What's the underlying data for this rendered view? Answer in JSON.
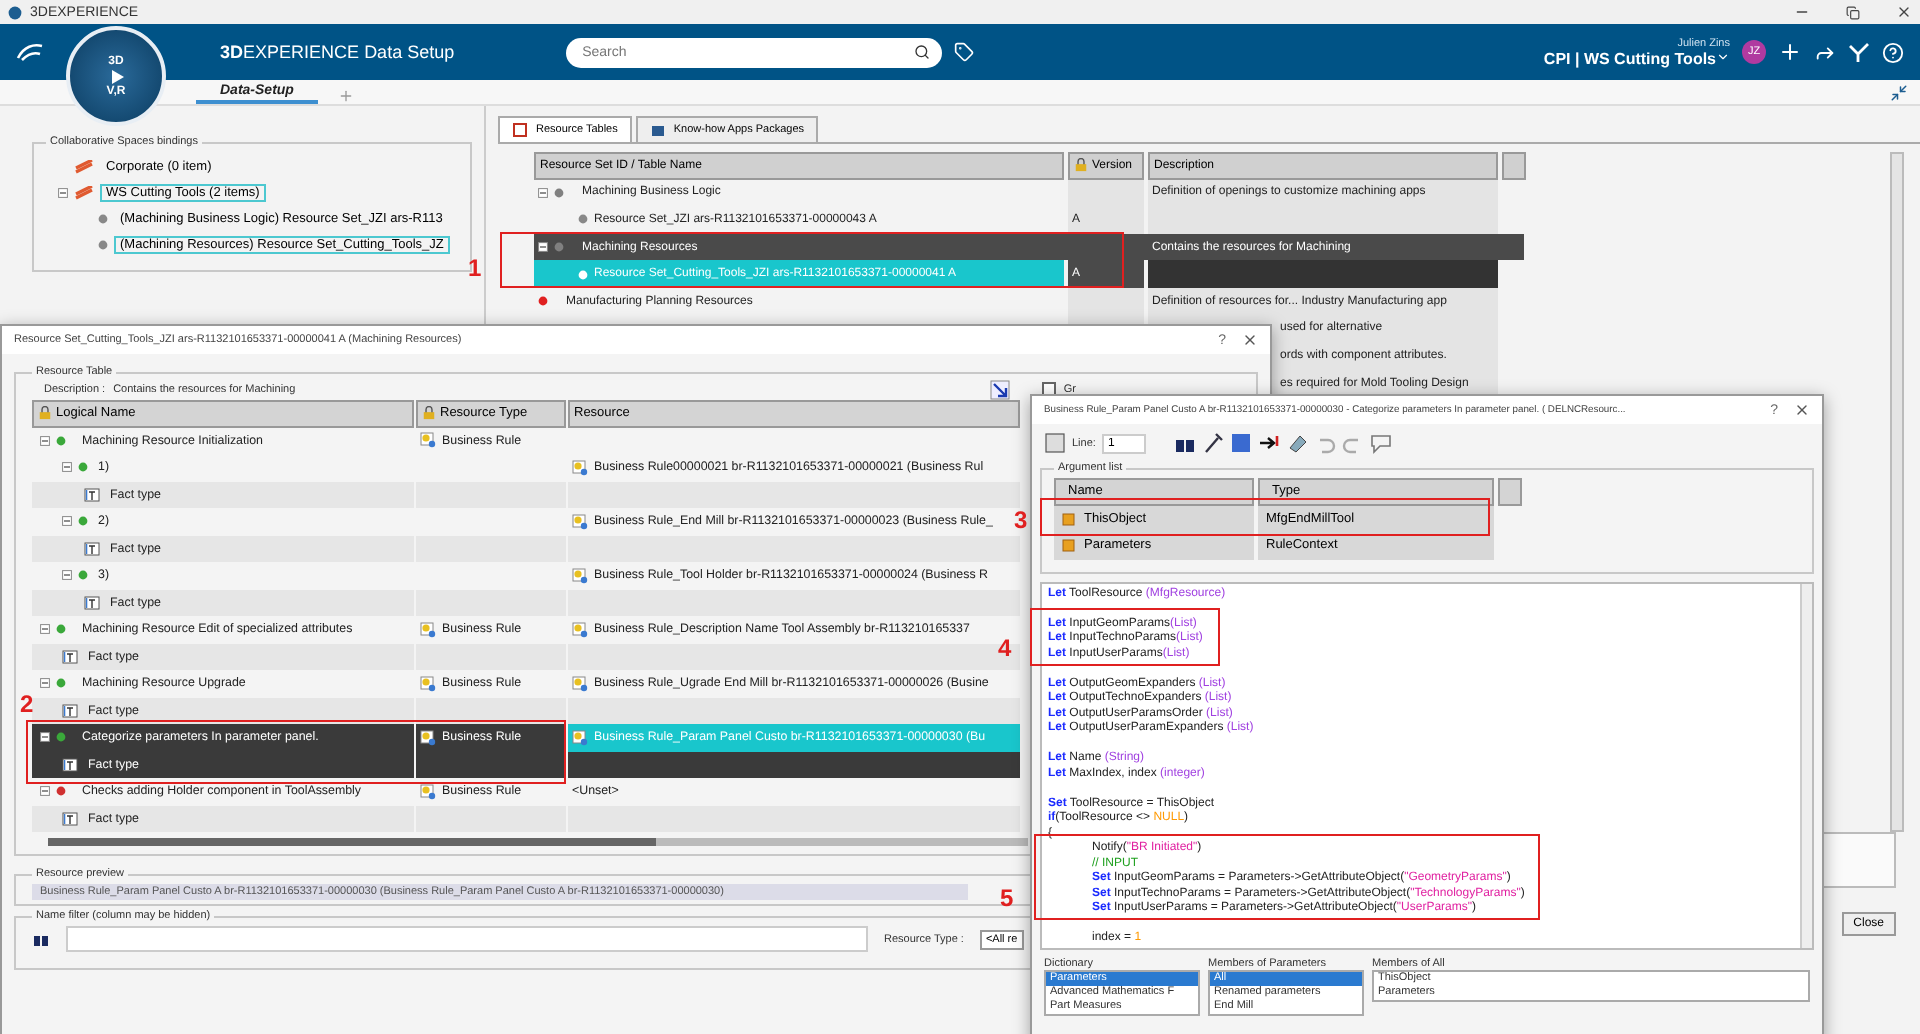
{
  "app_title": "3DEXPERIENCE",
  "header": {
    "brand_bold": "3D",
    "brand_rest": "EXPERIENCE",
    "app_name": "Data Setup",
    "compass_left": "3D",
    "compass_bottom": "V,R",
    "search": {
      "placeholder": "Search"
    },
    "user_name": "Julien Zins",
    "context": "CPI | WS Cutting Tools",
    "avatar": "JZ"
  },
  "tabs": [
    {
      "label": "Data-Setup",
      "selected": true
    }
  ],
  "bindings": {
    "title": "Collaborative Spaces bindings",
    "items": [
      {
        "label": "Corporate",
        "count": "(0 item)",
        "selected": false
      },
      {
        "label": "WS Cutting Tools",
        "count": "(2 items)",
        "selected": true,
        "expanded": true,
        "children": [
          {
            "label": "(Machining Business Logic) Resource Set_JZI ars-R113",
            "selected": false
          },
          {
            "label": "(Machining Resources) Resource Set_Cutting_Tools_JZ",
            "selected": true
          }
        ]
      }
    ]
  },
  "resource_tabs": [
    {
      "label": "Resource Tables",
      "selected": true
    },
    {
      "label": "Know-how Apps Packages",
      "selected": false
    }
  ],
  "resource_table": {
    "columns": [
      "Resource Set ID / Table Name",
      "Version",
      "Description"
    ],
    "rows": [
      {
        "kind": "group",
        "name": "Machining Business Logic",
        "description": "Definition of openings to customize machining apps",
        "color": "#808080",
        "selected": false,
        "expanded": true,
        "children": [
          {
            "name": "Resource Set_JZI ars-R1132101653371-00000043 A",
            "version": "A",
            "selected": false
          }
        ]
      },
      {
        "kind": "group",
        "name": "Machining Resources",
        "description": "Contains the resources for Machining",
        "color": "#808080",
        "selected": true,
        "expanded": true,
        "children": [
          {
            "name": "Resource Set_Cutting_Tools_JZI ars-R1132101653371-00000041 A",
            "version": "A",
            "selected": true
          }
        ]
      },
      {
        "kind": "group",
        "name": "Manufacturing Planning Resources",
        "description": "Definition of resources for... Industry Manufacturing app",
        "color": "#e02020",
        "selected": false
      },
      {
        "kind": "covered",
        "description": "used for alternative"
      },
      {
        "kind": "covered",
        "description": "ords with component attributes."
      },
      {
        "kind": "covered",
        "description": "es required for Mold Tooling Design"
      }
    ]
  },
  "close_button": "Close",
  "resource_dialog": {
    "title": "Resource Set_Cutting_Tools_JZI ars-R1132101653371-00000041 A (Machining Resources)",
    "help": "?",
    "section": "Resource Table",
    "description_label": "Description :",
    "description": "Contains the resources for Machining",
    "option": {
      "label": "Gr",
      "checked": false
    },
    "columns": [
      "Logical Name",
      "Resource Type",
      "Resource"
    ],
    "rows": [
      {
        "name": "Machining Resource Initialization",
        "type": "Business Rule",
        "color": "#3aa83a",
        "selected": false,
        "children": [
          {
            "name": "1)",
            "resource": "Business Rule00000021 br-R1132101653371-00000021 (Business Rul",
            "children": [
              {
                "name": "Fact type"
              }
            ]
          },
          {
            "name": "2)",
            "resource": "Business Rule_End Mill br-R1132101653371-00000023 (Business Rule_",
            "children": [
              {
                "name": "Fact type"
              }
            ]
          },
          {
            "name": "3)",
            "resource": "Business Rule_Tool Holder br-R1132101653371-00000024 (Business R",
            "children": [
              {
                "name": "Fact type"
              }
            ]
          }
        ]
      },
      {
        "name": "Machining Resource Edit of specialized attributes",
        "type": "Business Rule",
        "resource": "Business Rule_Description Name Tool Assembly br-R113210165337",
        "color": "#3aa83a",
        "selected": false,
        "children": [
          {
            "name": "Fact type"
          }
        ]
      },
      {
        "name": "Machining Resource Upgrade",
        "type": "Business Rule",
        "resource": "Business Rule_Ugrade End Mill br-R1132101653371-00000026 (Busine",
        "color": "#3aa83a",
        "selected": false,
        "children": [
          {
            "name": "Fact type"
          }
        ]
      },
      {
        "name": "Categorize parameters In parameter panel.",
        "type": "Business Rule",
        "resource": "Business Rule_Param Panel Custo br-R1132101653371-00000030 (Bu",
        "color": "#3aa83a",
        "selected": true,
        "children": [
          {
            "name": "Fact type"
          }
        ]
      },
      {
        "name": "Checks adding Holder component in ToolAssembly",
        "type": "Business Rule",
        "resource": "<Unset>",
        "color": "#d03030",
        "selected": false,
        "children": [
          {
            "name": "Fact type"
          }
        ]
      }
    ],
    "preview": {
      "title": "Resource preview",
      "text": "Business Rule_Param Panel Custo A br-R1132101653371-00000030 (Business Rule_Param Panel Custo A br-R1132101653371-00000030)"
    },
    "filter": {
      "title": "Name filter (column may be hidden)",
      "type_label": "Resource Type :",
      "type_value": "<All re"
    }
  },
  "rule_dialog": {
    "title": "Business Rule_Param Panel Custo A br-R1132101653371-00000030 - Categorize parameters In parameter panel.  ( DELNCResourc...",
    "help": "?",
    "line_label": "Line:",
    "line_value": "1",
    "arguments": {
      "title": "Argument list",
      "columns": [
        "Name",
        "Type"
      ],
      "rows": [
        {
          "name": "ThisObject",
          "type": "MfgEndMillTool"
        },
        {
          "name": "Parameters",
          "type": "RuleContext"
        }
      ]
    },
    "code": [
      {
        "kind": "code",
        "indented": false,
        "parts": [
          {
            "kind": "keyword",
            "text": "Let"
          },
          {
            "kind": "plain",
            "text": " ToolResource "
          },
          {
            "kind": "type",
            "text": "(MfgResource)"
          }
        ]
      },
      {
        "kind": "blank"
      },
      {
        "kind": "code",
        "indented": false,
        "parts": [
          {
            "kind": "keyword",
            "text": "Let"
          },
          {
            "kind": "plain",
            "text": " InputGeomParams"
          },
          {
            "kind": "type",
            "text": "(List)"
          }
        ]
      },
      {
        "kind": "code",
        "indented": false,
        "parts": [
          {
            "kind": "keyword",
            "text": "Let"
          },
          {
            "kind": "plain",
            "text": " InputTechnoParams"
          },
          {
            "kind": "type",
            "text": "(List)"
          }
        ]
      },
      {
        "kind": "code",
        "indented": false,
        "parts": [
          {
            "kind": "keyword",
            "text": "Let"
          },
          {
            "kind": "plain",
            "text": " InputUserParams"
          },
          {
            "kind": "type",
            "text": "(List)"
          }
        ]
      },
      {
        "kind": "blank"
      },
      {
        "kind": "code",
        "indented": false,
        "parts": [
          {
            "kind": "keyword",
            "text": "Let"
          },
          {
            "kind": "plain",
            "text": " OutputGeomExpanders "
          },
          {
            "kind": "type",
            "text": "(List)"
          }
        ]
      },
      {
        "kind": "code",
        "indented": false,
        "parts": [
          {
            "kind": "keyword",
            "text": "Let"
          },
          {
            "kind": "plain",
            "text": " OutputTechnoExpanders "
          },
          {
            "kind": "type",
            "text": "(List)"
          }
        ]
      },
      {
        "kind": "code",
        "indented": false,
        "parts": [
          {
            "kind": "keyword",
            "text": "Let"
          },
          {
            "kind": "plain",
            "text": " OutputUserParamsOrder "
          },
          {
            "kind": "type",
            "text": "(List)"
          }
        ]
      },
      {
        "kind": "code",
        "indented": false,
        "parts": [
          {
            "kind": "keyword",
            "text": "Let"
          },
          {
            "kind": "plain",
            "text": " OutputUserParamExpanders "
          },
          {
            "kind": "type",
            "text": "(List)"
          }
        ]
      },
      {
        "kind": "blank"
      },
      {
        "kind": "code",
        "indented": false,
        "parts": [
          {
            "kind": "keyword",
            "text": "Let"
          },
          {
            "kind": "plain",
            "text": " Name "
          },
          {
            "kind": "type",
            "text": "(String)"
          }
        ]
      },
      {
        "kind": "code",
        "indented": false,
        "parts": [
          {
            "kind": "keyword",
            "text": "Let"
          },
          {
            "kind": "plain",
            "text": " MaxIndex, index "
          },
          {
            "kind": "type",
            "text": "(integer)"
          }
        ]
      },
      {
        "kind": "blank"
      },
      {
        "kind": "code",
        "indented": false,
        "parts": [
          {
            "kind": "keyword",
            "text": "Set"
          },
          {
            "kind": "plain",
            "text": " ToolResource = ThisObject"
          }
        ]
      },
      {
        "kind": "code",
        "indented": false,
        "parts": [
          {
            "kind": "keyword",
            "text": "if"
          },
          {
            "kind": "plain",
            "text": "(ToolResource <> "
          },
          {
            "kind": "number",
            "text": "NULL"
          },
          {
            "kind": "plain",
            "text": ")"
          }
        ]
      },
      {
        "kind": "code",
        "indented": false,
        "parts": [
          {
            "kind": "plain",
            "text": "{"
          }
        ]
      },
      {
        "kind": "code",
        "indented": true,
        "parts": [
          {
            "kind": "plain",
            "text": "Notify("
          },
          {
            "kind": "string",
            "text": "\"BR Initiated\""
          },
          {
            "kind": "plain",
            "text": ")"
          }
        ]
      },
      {
        "kind": "code",
        "indented": true,
        "parts": [
          {
            "kind": "comment",
            "text": "// INPUT"
          }
        ]
      },
      {
        "kind": "code",
        "indented": true,
        "parts": [
          {
            "kind": "keyword",
            "text": "Set"
          },
          {
            "kind": "plain",
            "text": " InputGeomParams = Parameters->GetAttributeObject("
          },
          {
            "kind": "string",
            "text": "\"GeometryParams\""
          },
          {
            "kind": "plain",
            "text": ")"
          }
        ]
      },
      {
        "kind": "code",
        "indented": true,
        "parts": [
          {
            "kind": "keyword",
            "text": "Set"
          },
          {
            "kind": "plain",
            "text": " InputTechnoParams = Parameters->GetAttributeObject("
          },
          {
            "kind": "string",
            "text": "\"TechnologyParams\""
          },
          {
            "kind": "plain",
            "text": ")"
          }
        ]
      },
      {
        "kind": "code",
        "indented": true,
        "parts": [
          {
            "kind": "keyword",
            "text": "Set"
          },
          {
            "kind": "plain",
            "text": " InputUserParams = Parameters->GetAttributeObject("
          },
          {
            "kind": "string",
            "text": "\"UserParams\""
          },
          {
            "kind": "plain",
            "text": ")"
          }
        ]
      },
      {
        "kind": "blank"
      },
      {
        "kind": "code",
        "indented": true,
        "parts": [
          {
            "kind": "plain",
            "text": "index = "
          },
          {
            "kind": "number",
            "text": "1"
          }
        ]
      }
    ],
    "dictionary": [
      {
        "title": "Dictionary",
        "items": [
          {
            "label": "Parameters",
            "selected": true
          },
          {
            "label": "Advanced Mathematics F",
            "selected": false
          },
          {
            "label": "Part Measures",
            "selected": false
          }
        ]
      },
      {
        "title": "Members of Parameters",
        "items": [
          {
            "label": "All",
            "selected": true
          },
          {
            "label": "Renamed parameters",
            "selected": false
          },
          {
            "label": "End Mill",
            "selected": false
          }
        ]
      },
      {
        "title": "Members of All",
        "items": [
          {
            "label": "ThisObject",
            "selected": false
          },
          {
            "label": "Parameters",
            "selected": false
          }
        ]
      }
    ]
  },
  "annotations": [
    {
      "label": "1"
    },
    {
      "label": "2"
    },
    {
      "label": "3"
    },
    {
      "label": "4"
    },
    {
      "label": "5"
    }
  ]
}
